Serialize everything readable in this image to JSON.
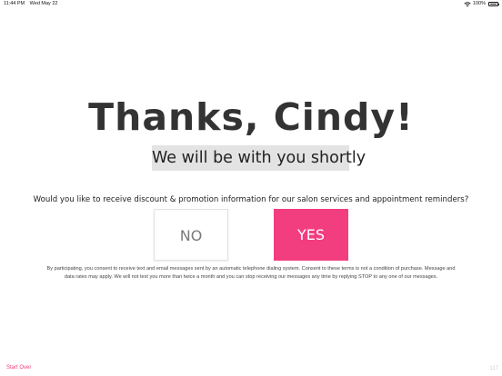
{
  "status_bar": {
    "time": "11:44 PM",
    "date": "Wed May 22",
    "wifi_icon": "wifi-icon",
    "battery_percent": "100%",
    "battery_icon": "battery-icon"
  },
  "main": {
    "title": "Thanks, Cindy!",
    "subtitle": "We will be with you shortly",
    "question": "Would you like to receive discount & promotion information for our salon services and appointment reminders?",
    "buttons": {
      "no_label": "NO",
      "yes_label": "YES"
    },
    "disclaimer": "By participating, you consent to receive text and email messages sent by an automatic telephone dialing system. Consent to these terms is not a condition of purchase. Message and data rates may apply. We will not text you more than twice a month and you can stop receiving our messages any time by replying STOP to any one of our messages."
  },
  "footer": {
    "start_over_label": "Start Over",
    "version": "117"
  },
  "colors": {
    "accent": "#f23d7e",
    "subtitle_bg": "#e3e3e3",
    "text": "#333333"
  }
}
